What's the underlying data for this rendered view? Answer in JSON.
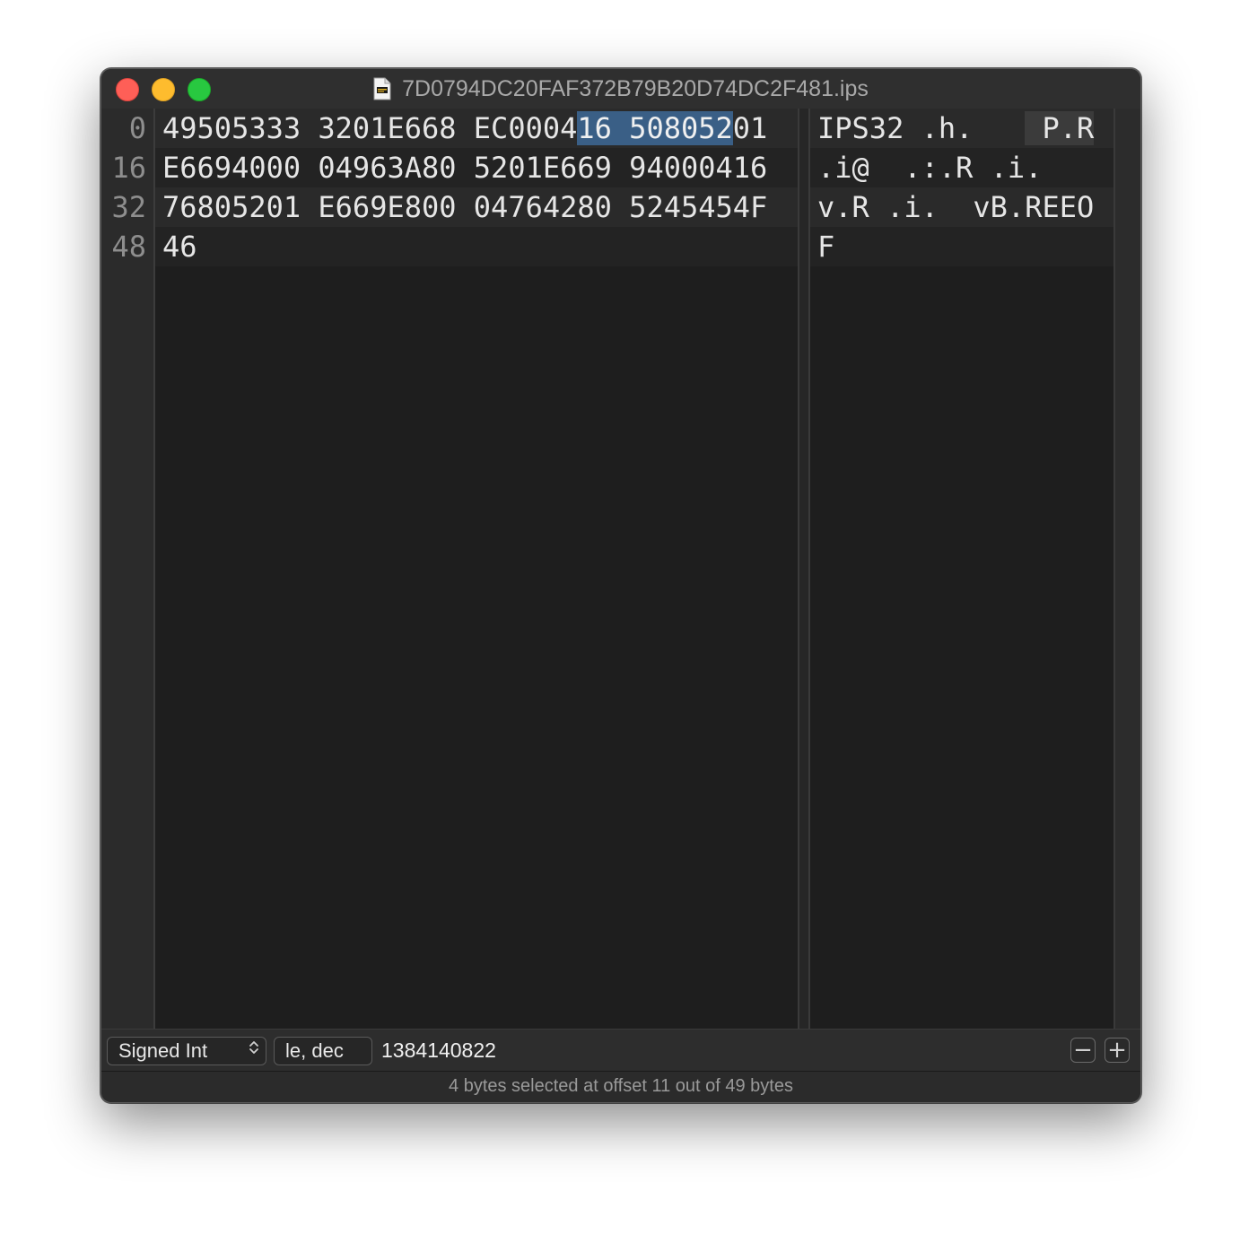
{
  "window": {
    "title": "7D0794DC20FAF372B79B20D74DC2F481.ips",
    "file_icon": "document-icon"
  },
  "gutter": {
    "offsets": [
      "0",
      "16",
      "32",
      "48"
    ]
  },
  "hex_rows": [
    {
      "before": "49505333 3201E668 EC0004",
      "selected": "16 508052",
      "after": "01"
    },
    {
      "before": "E6694000 04963A80 5201E669 94000416",
      "selected": "",
      "after": ""
    },
    {
      "before": "76805201 E669E800 04764280 5245454F",
      "selected": "",
      "after": ""
    },
    {
      "before": "46",
      "selected": "",
      "after": ""
    }
  ],
  "ascii_rows": [
    {
      "before": "IPS32 .h.   ",
      "selected": " P.R",
      "after": ""
    },
    {
      "before": ".i@  .:.R .i.",
      "selected": "",
      "after": ""
    },
    {
      "before": "v.R .i.  vB.REEO",
      "selected": "",
      "after": ""
    },
    {
      "before": "F",
      "selected": "",
      "after": ""
    }
  ],
  "inspector": {
    "type_label": "Signed Int",
    "format_label": "le, dec",
    "value": "1384140822",
    "minus_label": "−",
    "plus_label": "+"
  },
  "status": {
    "text": "4 bytes selected at offset 11 out of 49 bytes"
  },
  "colors": {
    "selection": "#3a5f86",
    "close": "#fe5f57",
    "minimize": "#febc2e",
    "zoom": "#28c840"
  }
}
